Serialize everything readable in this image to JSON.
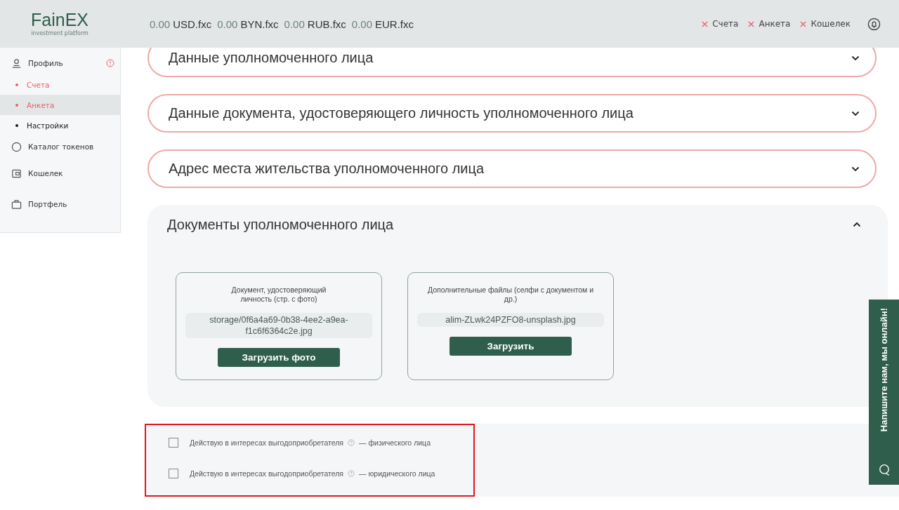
{
  "header": {
    "logo": {
      "name": "FainEX",
      "tagline": "investment platform"
    },
    "balances": [
      {
        "amount": "0.00",
        "currency": "USD.fxc"
      },
      {
        "amount": "0.00",
        "currency": "BYN.fxc"
      },
      {
        "amount": "0.00",
        "currency": "RUB.fxc"
      },
      {
        "amount": "0.00",
        "currency": "EUR.fxc"
      }
    ],
    "status_items": [
      {
        "label": "Счета",
        "done": false
      },
      {
        "label": "Анкета",
        "done": false
      },
      {
        "label": "Кошелек",
        "done": false
      }
    ]
  },
  "sidebar": {
    "items": [
      {
        "label": "Профиль",
        "kind": "profile",
        "alert": true,
        "children": [
          {
            "label": "Счета",
            "selected": false,
            "color": "#e8606f"
          },
          {
            "label": "Анкета",
            "selected": true,
            "color": "#e8606f"
          },
          {
            "label": "Настройки",
            "selected": false,
            "color": "#1a1a1a"
          }
        ]
      },
      {
        "label": "Каталог токенов",
        "kind": "catalog",
        "alert": false
      },
      {
        "label": "Кошелек",
        "kind": "wallet",
        "alert": false
      },
      {
        "label": "Портфель",
        "kind": "portfolio",
        "alert": false
      }
    ]
  },
  "sections": [
    {
      "title": "Данные уполномоченного лица",
      "expanded": false,
      "invalid": true
    },
    {
      "title": "Данные документа, удостоверяющего личность уполномоченного лица",
      "expanded": false,
      "invalid": true
    },
    {
      "title": "Адрес места жительства уполномоченного лица",
      "expanded": false,
      "invalid": true
    },
    {
      "title": "Документы уполномоченного лица",
      "expanded": true,
      "invalid": false,
      "documents": [
        {
          "caption": "Документ, удостоверяющий личность (стр. с фото)",
          "file": "storage/0f6a4a69-0b38-4ee2-a9ea-f1c6f6364c2e.jpg",
          "button": "Загрузить фото"
        },
        {
          "caption": "Дополнительные файлы (селфи с документом и др.)",
          "file": "alim-ZLwk24PZFO8-unsplash.jpg",
          "button": "Загрузить"
        }
      ]
    }
  ],
  "beneficiary_options": [
    {
      "label": "Действую в интересах выгодоприобретателя",
      "suffix": "— физического лица",
      "checked": false
    },
    {
      "label": "Действую в интересах выгодоприобретателя",
      "suffix": "— юридического лица",
      "checked": false
    }
  ],
  "chat_tab": {
    "label": "Напишите нам, мы онлайн!"
  }
}
